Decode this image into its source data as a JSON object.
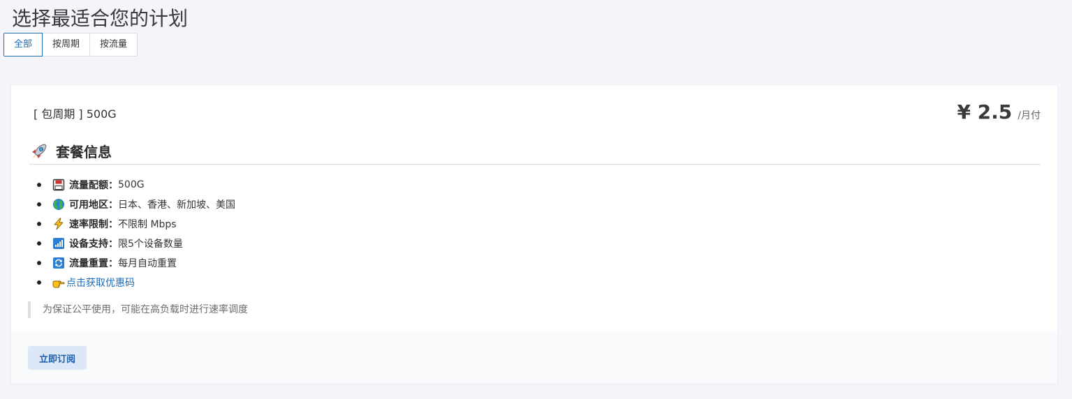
{
  "page": {
    "title": "选择最适合您的计划"
  },
  "tabs": [
    {
      "label": "全部",
      "active": true
    },
    {
      "label": "按周期",
      "active": false
    },
    {
      "label": "按流量",
      "active": false
    }
  ],
  "plan": {
    "name": "[ 包周期 ]  500G",
    "price": "¥ 2.5",
    "price_unit": "/月付",
    "section_title": "套餐信息",
    "section_icon": "rocket-icon",
    "features": [
      {
        "icon": "floppy-disk-icon",
        "label": "流量配额",
        "sep": "：",
        "value": "500G"
      },
      {
        "icon": "globe-icon",
        "label": "可用地区",
        "sep": "：",
        "value": "日本、香港、新加坡、美国"
      },
      {
        "icon": "lightning-icon",
        "label": "速率限制",
        "sep": "：",
        "value": "不限制 Mbps"
      },
      {
        "icon": "signal-bars-icon",
        "label": "设备支持",
        "sep": "：",
        "value": "限5个设备数量"
      },
      {
        "icon": "repeat-icon",
        "label": "流量重置",
        "sep": "：",
        "value": "每月自动重置"
      }
    ],
    "coupon": {
      "icon": "pointing-hand-icon",
      "label": "点击获取优惠码"
    },
    "notice": "为保证公平使用，可能在高负载时进行速率调度",
    "subscribe_label": "立即订阅"
  },
  "colors": {
    "accent": "#1e6bb8",
    "background": "#f4f5fa",
    "button_bg": "#dce8f7"
  }
}
